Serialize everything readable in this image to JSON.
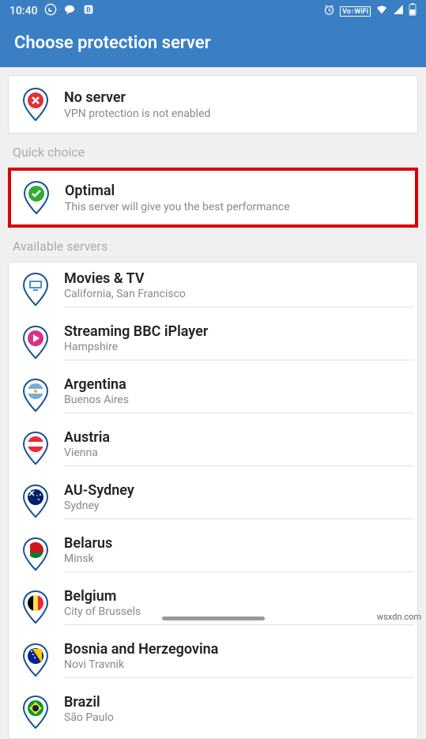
{
  "status": {
    "time": "10:40",
    "vowifi": "Vo↑WiFi"
  },
  "header": {
    "title": "Choose protection server"
  },
  "noServer": {
    "title": "No server",
    "subtitle": "VPN protection is not enabled"
  },
  "quickChoice": {
    "header": "Quick choice",
    "optimal": {
      "title": "Optimal",
      "subtitle": "This server will give you the best performance"
    }
  },
  "availableServers": {
    "header": "Available servers",
    "items": [
      {
        "title": "Movies & TV",
        "subtitle": "California, San Francisco",
        "icon": "tv"
      },
      {
        "title": "Streaming BBC iPlayer",
        "subtitle": "Hampshire",
        "icon": "play"
      },
      {
        "title": "Argentina",
        "subtitle": "Buenos Aires",
        "icon": "flag-ar"
      },
      {
        "title": "Austria",
        "subtitle": "Vienna",
        "icon": "flag-at"
      },
      {
        "title": "AU-Sydney",
        "subtitle": "Sydney",
        "icon": "flag-au"
      },
      {
        "title": "Belarus",
        "subtitle": "Minsk",
        "icon": "flag-by"
      },
      {
        "title": "Belgium",
        "subtitle": "City of Brussels",
        "icon": "flag-be"
      },
      {
        "title": "Bosnia and Herzegovina",
        "subtitle": "Novi Travnik",
        "icon": "flag-ba"
      },
      {
        "title": "Brazil",
        "subtitle": "São Paulo",
        "icon": "flag-br"
      }
    ]
  },
  "watermark": "wsxdn.com"
}
